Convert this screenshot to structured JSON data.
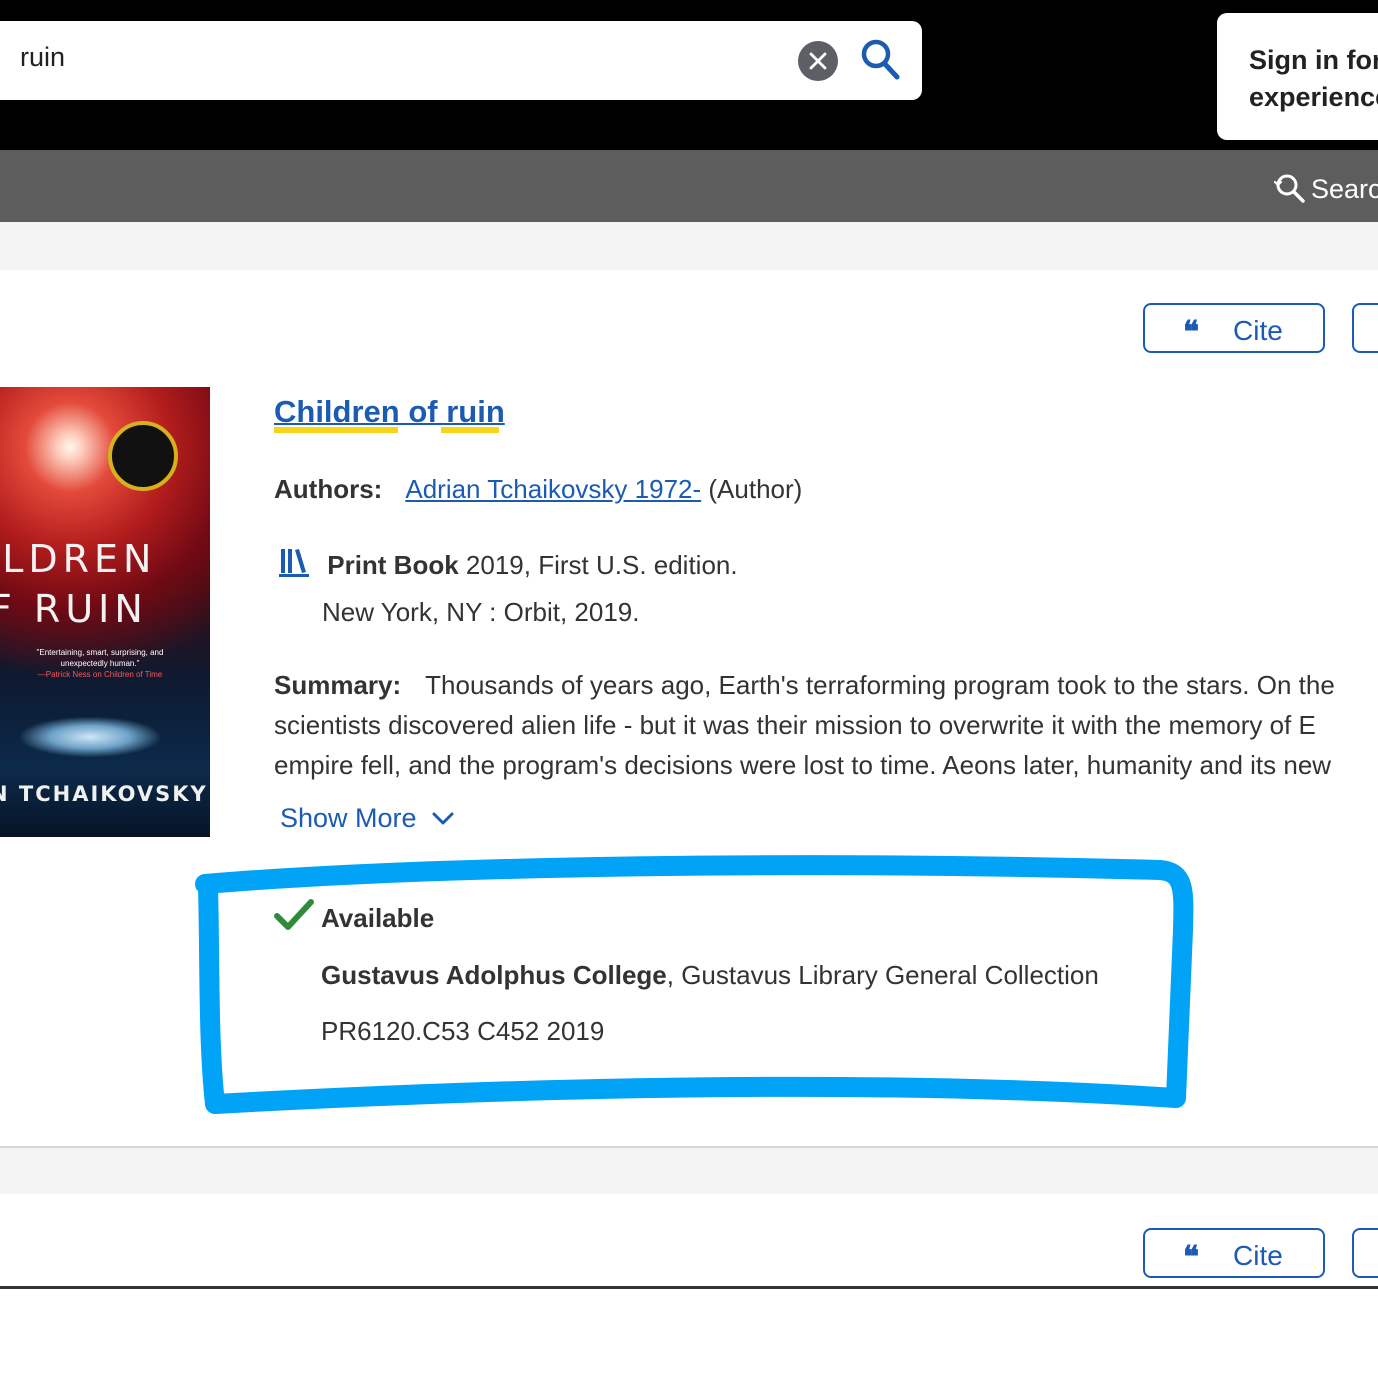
{
  "search": {
    "value": "ruin",
    "clear_icon": "clear-circle-icon",
    "search_icon": "magnifier-icon"
  },
  "signin": {
    "line1": "Sign in for",
    "line2": "experience"
  },
  "subbar": {
    "search_label": "Search"
  },
  "result": {
    "cite_label": "Cite",
    "title": "Children of ruin",
    "authors_label": "Authors:",
    "author_name": "Adrian Tchaikovsky 1972-",
    "author_role": "(Author)",
    "format_label": "Print Book",
    "format_detail": "2019, First U.S. edition.",
    "publisher": "New York, NY : Orbit, 2019.",
    "summary_label": "Summary:",
    "summary_lines": [
      "Thousands of years ago, Earth's terraforming program took to the stars. On the",
      "scientists discovered alien life - but it was their mission to overwrite it with the memory of E",
      "empire fell, and the program's decisions were lost to time. Aeons later, humanity and its new"
    ],
    "show_more": "Show More",
    "availability": "Available",
    "library": "Gustavus Adolphus College",
    "collection": ", Gustavus Library General Collection",
    "call_number": "PR6120.C53 C452 2019",
    "cover": {
      "title_line1": "ILDREN",
      "title_line2": "F RUIN",
      "author": "N TCHAIKOVSKY",
      "quote": "\"Entertaining, smart, surprising, and unexpectedly human.\"",
      "quote_source": "—Patrick Ness on Children of Time"
    }
  },
  "result2": {
    "cite_label": "Cite"
  },
  "colors": {
    "link": "#1b5bb4",
    "highlight": "#f7d31a",
    "annotation": "#00a3f5",
    "available_check": "#2e8b3a"
  }
}
